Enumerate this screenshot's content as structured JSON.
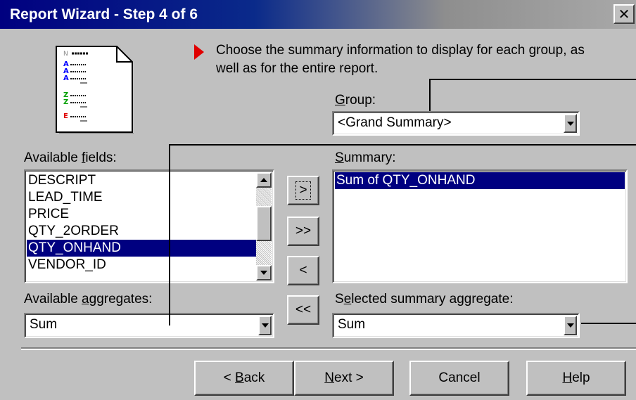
{
  "window": {
    "title": "Report Wizard - Step 4 of 6",
    "close_glyph": "✕"
  },
  "instructions": {
    "line1": "Choose the summary information to display for each group, as",
    "line2": "well as for the entire report."
  },
  "group": {
    "label_accel": "G",
    "label_rest": "roup:",
    "value": "<Grand Summary>"
  },
  "available_fields": {
    "label_pre": "Available ",
    "label_accel": "f",
    "label_rest": "ields:",
    "items": [
      "DESCRIPT",
      "LEAD_TIME",
      "PRICE",
      "QTY_2ORDER",
      "QTY_ONHAND",
      "VENDOR_ID"
    ],
    "selected_index": 4
  },
  "summary": {
    "label_accel": "S",
    "label_rest": "ummary:",
    "items": [
      "Sum of QTY_ONHAND"
    ],
    "selected_index": 0
  },
  "move_buttons": {
    "add": ">",
    "add_all": ">>",
    "remove": "<",
    "remove_all": "<<"
  },
  "available_aggregates": {
    "label_pre": "Available ",
    "label_accel": "a",
    "label_rest": "ggregates:",
    "value": "Sum"
  },
  "selected_summary_aggregate": {
    "label_pre": "S",
    "label_accel": "e",
    "label_rest": "lected summary aggregate:",
    "value": "Sum"
  },
  "footer": {
    "back_pre": "< ",
    "back_accel": "B",
    "back_rest": "ack",
    "next_accel": "N",
    "next_rest": "ext >",
    "cancel": "Cancel",
    "help_accel": "H",
    "help_rest": "elp"
  },
  "colors": {
    "title_bar": "#000080",
    "selection": "#000080",
    "face": "#c0c0c0",
    "arrow_indicator": "#e00000"
  }
}
